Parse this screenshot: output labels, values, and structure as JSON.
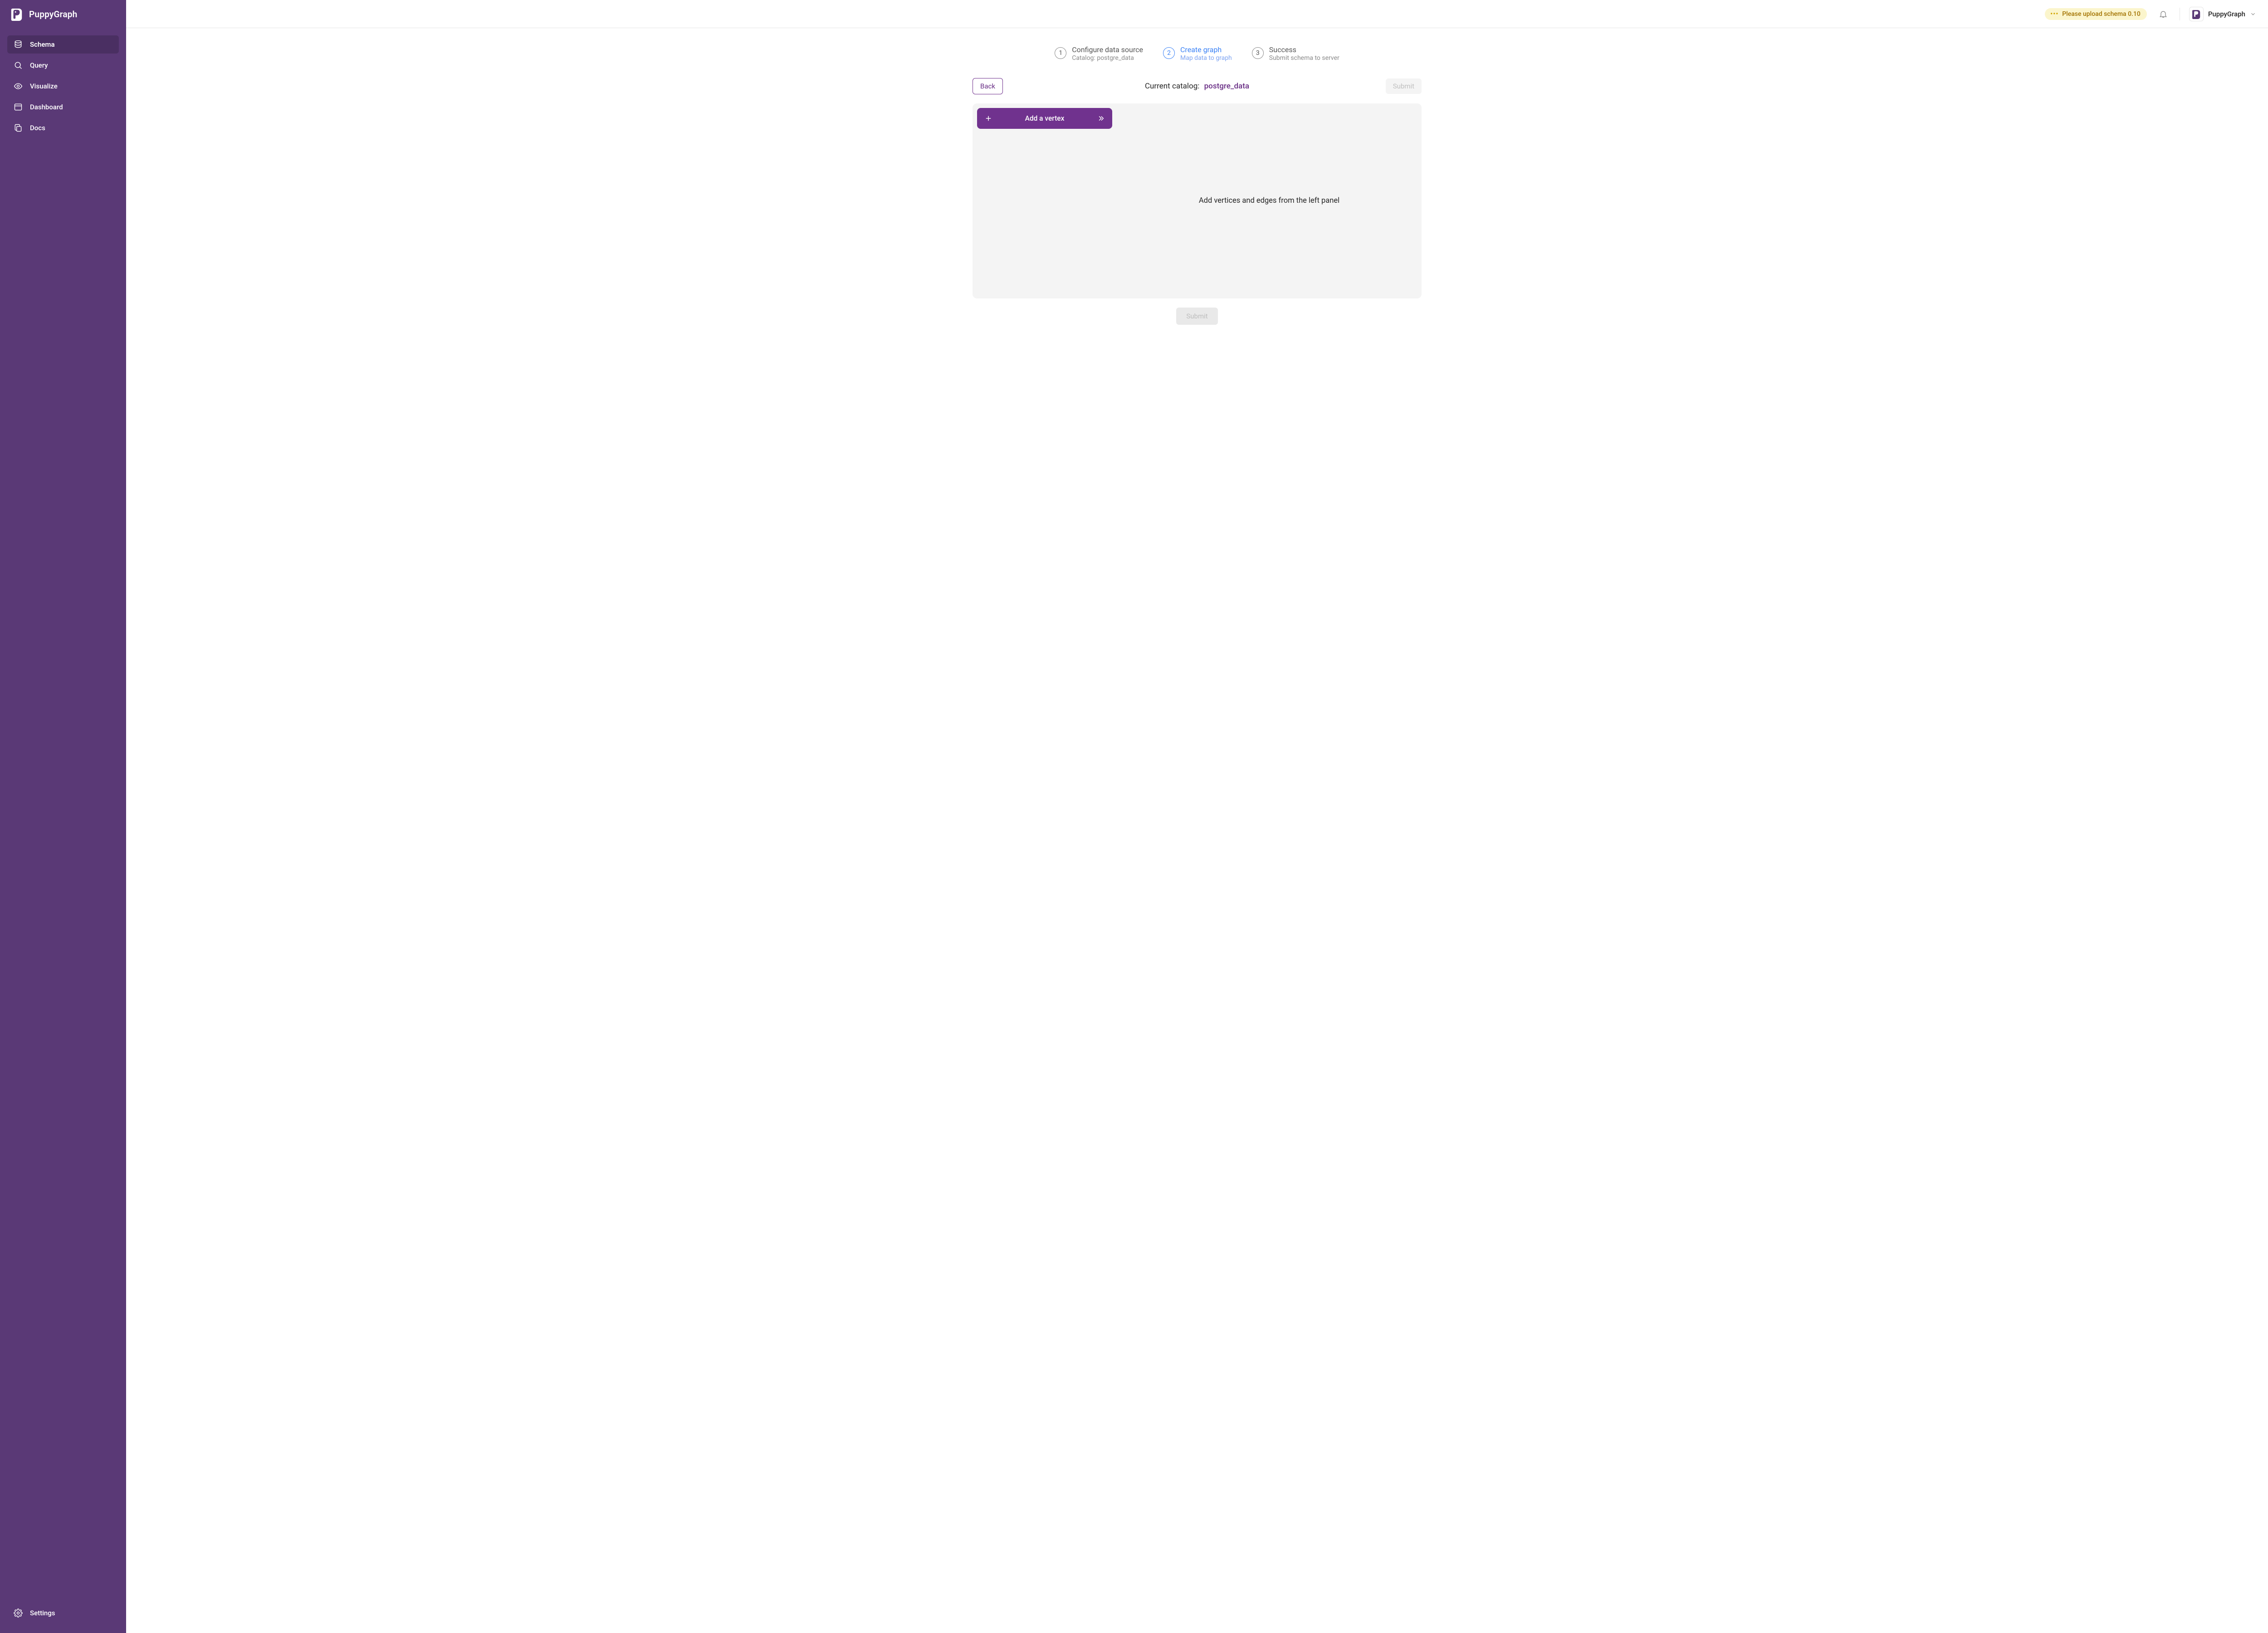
{
  "brand": {
    "name": "PuppyGraph"
  },
  "sidebar": {
    "items": [
      {
        "label": "Schema",
        "active": true
      },
      {
        "label": "Query"
      },
      {
        "label": "Visualize"
      },
      {
        "label": "Dashboard"
      },
      {
        "label": "Docs"
      }
    ],
    "footer": {
      "label": "Settings"
    }
  },
  "topbar": {
    "warning": {
      "text": "Please upload schema 0.10"
    },
    "user": {
      "name": "PuppyGraph"
    }
  },
  "stepper": [
    {
      "num": "1",
      "title": "Configure data source",
      "sub": "Catalog: postgre_data",
      "active": false
    },
    {
      "num": "2",
      "title": "Create graph",
      "sub": "Map data to graph",
      "active": true
    },
    {
      "num": "3",
      "title": "Success",
      "sub": "Submit schema to server",
      "active": false
    }
  ],
  "toolbar": {
    "back_label": "Back",
    "current_label": "Current catalog:",
    "current_value": "postgre_data",
    "submit_label": "Submit"
  },
  "panel": {
    "add_vertex_label": "Add a vertex",
    "placeholder": "Add vertices and edges from the left panel"
  },
  "footer_submit": "Submit"
}
